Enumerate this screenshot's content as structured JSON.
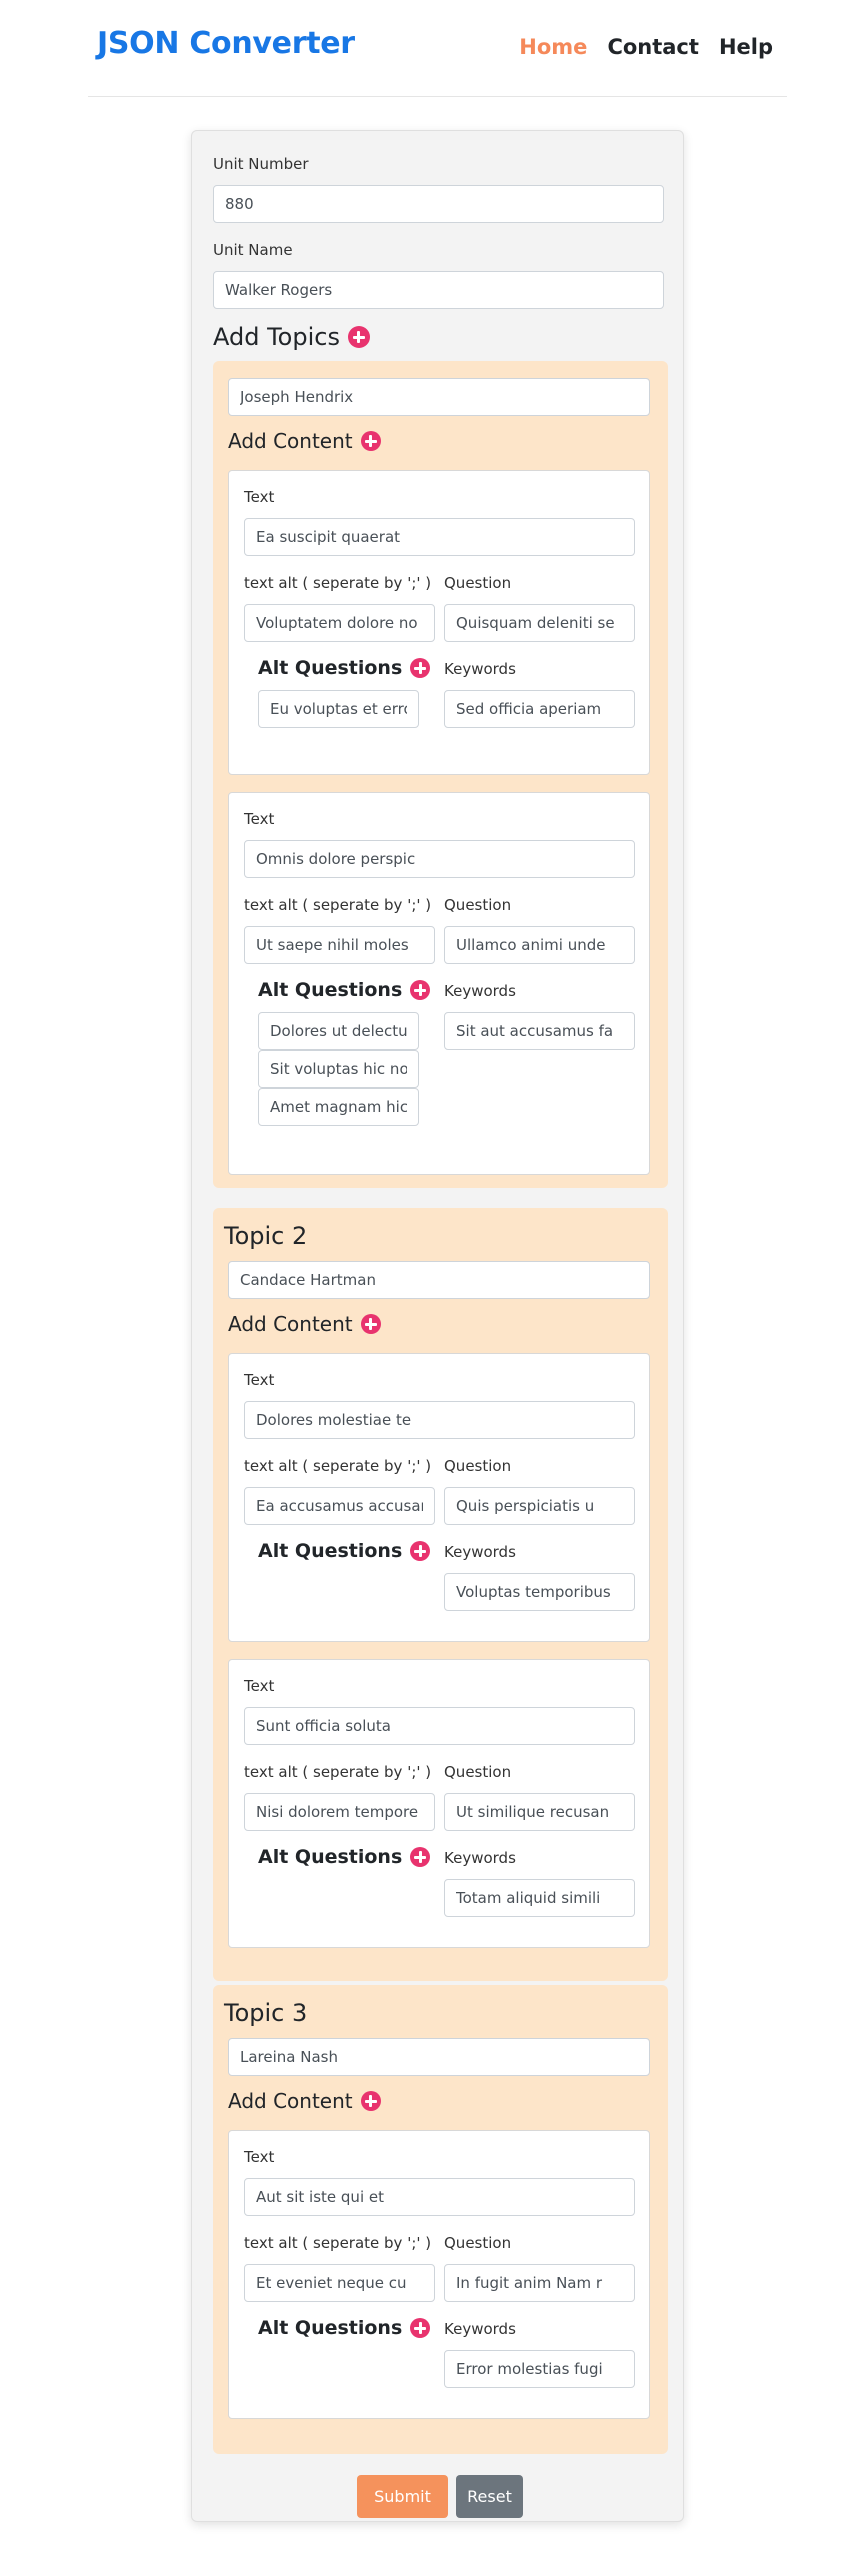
{
  "header": {
    "brand": "JSON Converter",
    "nav": [
      "Home",
      "Contact",
      "Help"
    ],
    "active_nav": "Home",
    "accent_color": "#f5895a",
    "brand_color": "#1877e5"
  },
  "form": {
    "unit_number_label": "Unit Number",
    "unit_number_value": "880",
    "unit_name_label": "Unit Name",
    "unit_name_value": "Walker Rogers",
    "add_topics_label": "Add Topics",
    "add_content_label": "Add Content",
    "text_label": "Text",
    "text_alt_label": "text alt ( seperate by ';' )",
    "question_label": "Question",
    "alt_questions_label": "Alt Questions",
    "keywords_label": "Keywords",
    "add_icon": "plus-circle-icon",
    "topics": [
      {
        "title": "",
        "name": "Joseph Hendrix",
        "contents": [
          {
            "text": "Ea suscipit quaerat",
            "text_alt": "Voluptatem dolore no",
            "question": "Quisquam deleniti se",
            "alt_questions": [
              "Eu voluptas et error"
            ],
            "keywords": "Sed officia aperiam"
          },
          {
            "text": "Omnis dolore perspic",
            "text_alt": "Ut saepe nihil moles",
            "question": "Ullamco animi unde",
            "alt_questions": [
              "Dolores ut delectus",
              "Sit voluptas hic nob",
              "Amet magnam hic u"
            ],
            "keywords": "Sit aut accusamus fa"
          }
        ]
      },
      {
        "title": "Topic 2",
        "name": "Candace Hartman",
        "contents": [
          {
            "text": "Dolores molestiae te",
            "text_alt": "Ea accusamus accusan",
            "question": "Quis perspiciatis u",
            "alt_questions": [],
            "keywords": "Voluptas temporibus"
          },
          {
            "text": "Sunt officia soluta",
            "text_alt": "Nisi dolorem tempore",
            "question": "Ut similique recusan",
            "alt_questions": [],
            "keywords": "Totam aliquid simili"
          }
        ]
      },
      {
        "title": "Topic 3",
        "name": "Lareina Nash",
        "contents": [
          {
            "text": "Aut sit iste qui et",
            "text_alt": "Et eveniet neque cu",
            "question": "In fugit anim Nam r",
            "alt_questions": [],
            "keywords": "Error molestias fugi"
          }
        ]
      }
    ],
    "submit_label": "Submit",
    "reset_label": "Reset"
  }
}
